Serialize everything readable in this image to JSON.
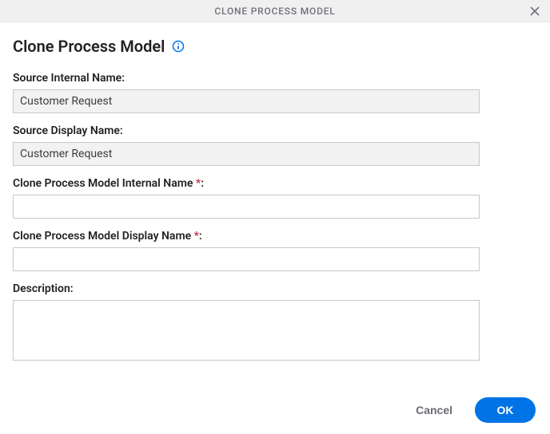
{
  "titlebar": {
    "title": "CLONE PROCESS MODEL"
  },
  "heading": "Clone Process Model",
  "fields": {
    "source_internal_name": {
      "label": "Source Internal Name:",
      "value": "Customer Request"
    },
    "source_display_name": {
      "label": "Source Display Name:",
      "value": "Customer Request"
    },
    "clone_internal_name": {
      "label_pre": "Clone Process Model Internal Name ",
      "asterisk": "*",
      "label_post": ":",
      "value": ""
    },
    "clone_display_name": {
      "label_pre": "Clone Process Model Display Name ",
      "asterisk": "*",
      "label_post": ":",
      "value": ""
    },
    "description": {
      "label": "Description:",
      "value": ""
    }
  },
  "footer": {
    "cancel": "Cancel",
    "ok": "OK"
  }
}
